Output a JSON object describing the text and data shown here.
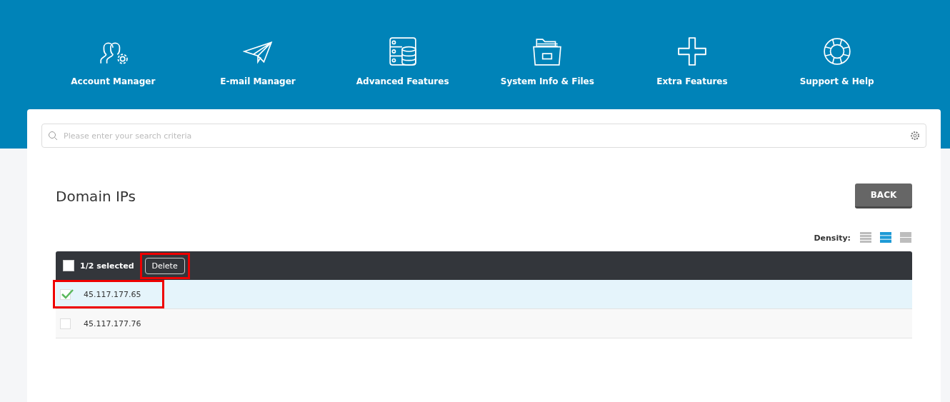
{
  "nav": [
    {
      "label": "Account Manager",
      "kind": "users"
    },
    {
      "label": "E-mail Manager",
      "kind": "plane"
    },
    {
      "label": "Advanced Features",
      "kind": "server"
    },
    {
      "label": "System Info & Files",
      "kind": "folder"
    },
    {
      "label": "Extra Features",
      "kind": "plus"
    },
    {
      "label": "Support & Help",
      "kind": "lifebuoy"
    }
  ],
  "search": {
    "placeholder": "Please enter your search criteria"
  },
  "page_title": "Domain IPs",
  "back_button": "BACK",
  "density": {
    "label": "Density:",
    "options": [
      {
        "kind": "compact",
        "selected": false
      },
      {
        "kind": "normal",
        "selected": true
      },
      {
        "kind": "large",
        "selected": false
      }
    ]
  },
  "table": {
    "header": {
      "checked": false,
      "selection": "1/2 selected",
      "delete_button": "Delete",
      "annotated": true
    },
    "rows": [
      {
        "ip": "45.117.177.65",
        "checked": true,
        "annotated": true
      },
      {
        "ip": "45.117.177.76",
        "checked": false,
        "annotated": false
      }
    ]
  }
}
